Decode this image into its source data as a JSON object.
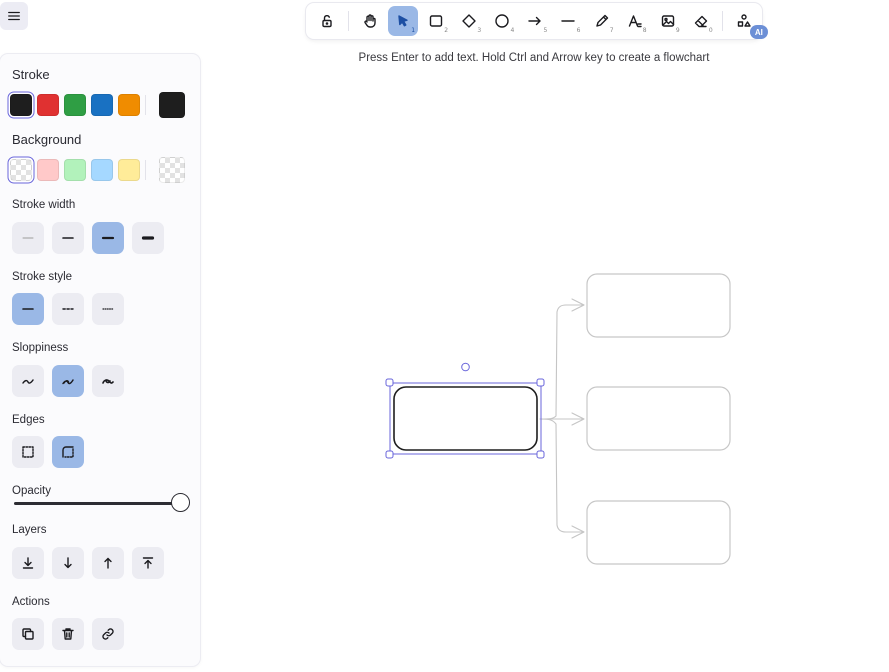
{
  "app": {
    "menu_icon": "hamburger-menu-icon",
    "hint": "Press Enter to add text. Hold Ctrl and Arrow key to create a flowchart"
  },
  "toolbar": {
    "tools": [
      {
        "name": "lock",
        "icon": "unlock-icon",
        "key": "",
        "active": false
      },
      {
        "name": "hand",
        "icon": "hand-icon",
        "key": "",
        "active": false
      },
      {
        "name": "selection",
        "icon": "pointer-icon",
        "key": "1",
        "active": true
      },
      {
        "name": "rectangle",
        "icon": "rectangle-icon",
        "key": "2",
        "active": false
      },
      {
        "name": "diamond",
        "icon": "diamond-icon",
        "key": "3",
        "active": false
      },
      {
        "name": "ellipse",
        "icon": "ellipse-icon",
        "key": "4",
        "active": false
      },
      {
        "name": "arrow",
        "icon": "arrow-icon",
        "key": "5",
        "active": false
      },
      {
        "name": "line",
        "icon": "line-icon",
        "key": "6",
        "active": false
      },
      {
        "name": "draw",
        "icon": "pencil-icon",
        "key": "7",
        "active": false
      },
      {
        "name": "text",
        "icon": "text-icon",
        "key": "8",
        "active": false
      },
      {
        "name": "image",
        "icon": "image-icon",
        "key": "9",
        "active": false
      },
      {
        "name": "eraser",
        "icon": "eraser-icon",
        "key": "0",
        "active": false
      },
      {
        "name": "more",
        "icon": "shapes-icon",
        "key": "",
        "active": false
      }
    ],
    "ai_badge": "AI"
  },
  "panel": {
    "stroke": {
      "label": "Stroke",
      "colors": [
        "#1e1e1e",
        "#e03131",
        "#2f9e44",
        "#1971c2",
        "#f08c00"
      ],
      "selected": "#1e1e1e"
    },
    "background": {
      "label": "Background",
      "colors": [
        "transparent",
        "#ffc9c9",
        "#b2f2bb",
        "#a5d8ff",
        "#ffec99"
      ],
      "selected": "transparent"
    },
    "stroke_width": {
      "label": "Stroke width",
      "options": [
        "thin",
        "bold",
        "extra-bold",
        "extra-extra-bold"
      ],
      "selected": "extra-bold"
    },
    "stroke_style": {
      "label": "Stroke style",
      "options": [
        "solid",
        "dashed",
        "dotted"
      ],
      "selected": "solid"
    },
    "sloppiness": {
      "label": "Sloppiness",
      "options": [
        "architect",
        "artist",
        "cartoonist"
      ],
      "selected": "artist"
    },
    "edges": {
      "label": "Edges",
      "options": [
        "sharp",
        "round"
      ],
      "selected": "round"
    },
    "opacity": {
      "label": "Opacity",
      "value": 100
    },
    "layers": {
      "label": "Layers",
      "options": [
        "send-to-back",
        "send-backward",
        "bring-forward",
        "bring-to-front"
      ]
    },
    "actions": {
      "label": "Actions",
      "options": [
        "duplicate",
        "delete",
        "link"
      ]
    }
  }
}
